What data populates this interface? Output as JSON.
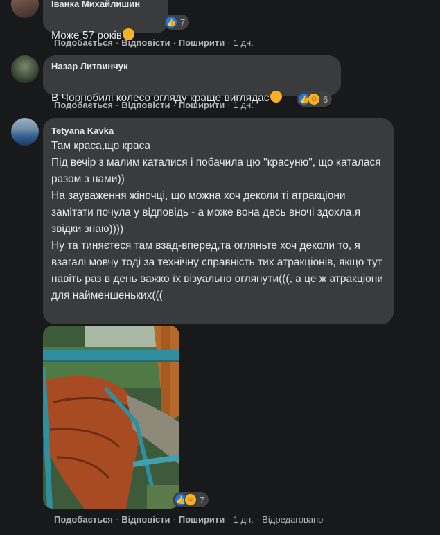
{
  "comments": [
    {
      "author": "Іванка Михайлишин",
      "text": "Може 57 років",
      "emoji": "thinking-face-emoji",
      "reactions": {
        "icons": [
          "like"
        ],
        "count": "7"
      },
      "actions": {
        "like": "Подобається",
        "reply": "Відповісти",
        "share": "Поширити",
        "time": "1 дн."
      }
    },
    {
      "author": "Назар Литвинчук",
      "text": "В Чорнобилі колесо огляду краще виглядає",
      "emoji": "grinning-face-emoji",
      "reactions": {
        "icons": [
          "like",
          "haha"
        ],
        "count": "6"
      },
      "actions": {
        "like": "Подобається",
        "reply": "Відповісти",
        "share": "Поширити",
        "time": "1 дн."
      }
    },
    {
      "author": "Tetyana Kavka",
      "text": "Там краса,що краса\nПід вечір з малим каталися і побачила цю \"красуню\", що каталася разом з нами))\nНа зауваження жіночці, що можна хоч деколи ті атракціони замітати почула у відповідь - а може вона десь вночі здохла,я звідки знаю))))\nНу та тиняєтеся там взад-вперед,та огляньте хоч деколи то, я взагалі мовчу тоді за технічну справність тих атракціонів, якщо тут навіть раз в день важко їх візуально оглянути(((, а це ж атракціони для найменшеньких(((",
      "reactions": {
        "icons": [
          "like",
          "wow"
        ],
        "count": "7"
      },
      "actions": {
        "like": "Подобається",
        "reply": "Відповісти",
        "share": "Поширити",
        "time": "1 дн.",
        "edited": "Відредаговано"
      }
    }
  ],
  "colors": {
    "background": "#18191a",
    "bubble": "#3a3b3c",
    "meta": "#b0b3b8",
    "like": "#1877f2",
    "emoji": "#f7b125"
  }
}
